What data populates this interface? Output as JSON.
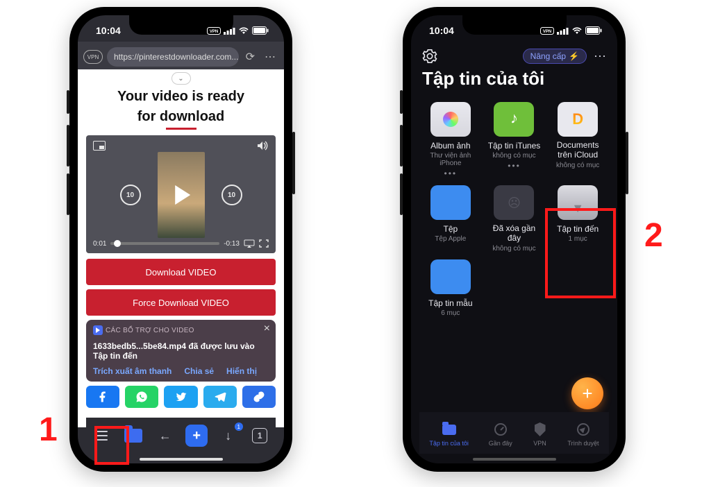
{
  "annotations": {
    "num1": "1",
    "num2": "2"
  },
  "left": {
    "status": {
      "time": "10:04"
    },
    "browser": {
      "vpn": "VPN",
      "url": "https://pinterestdownloader.com..."
    },
    "headline_l1": "Your video is ready",
    "headline_l2": "for download",
    "video": {
      "time_current": "0:01",
      "time_remain": "-0:13",
      "seek_back": "10",
      "seek_fwd": "10"
    },
    "buttons": {
      "download": "Download VIDEO",
      "force": "Force Download VIDEO"
    },
    "toast": {
      "badge": "CÁC BỔ TRỢ CHO VIDEO",
      "filename": "1633bedb5...5be84.mp4",
      "saved_suffix": " đã được lưu vào",
      "dest": "Tập tin đến",
      "actions": {
        "extract": "Trích xuất âm thanh",
        "share": "Chia sẻ",
        "show": "Hiển thị"
      }
    },
    "bottom": {
      "down_count": "1",
      "tabs": "1"
    }
  },
  "right": {
    "status": {
      "time": "10:04"
    },
    "header": {
      "upgrade": "Nâng cấp"
    },
    "title": "Tập tin của tôi",
    "grid": [
      {
        "icon": "photos",
        "t1": "Album ảnh",
        "t2": "Thư viện ảnh iPhone",
        "dots": true
      },
      {
        "icon": "itunes",
        "t1": "Tập tin iTunes",
        "t2": "không có mục",
        "dots": true
      },
      {
        "icon": "icloud",
        "t1": "Documents trên iCloud",
        "t2": "không có mục",
        "dots": false,
        "two_line_t1": true
      },
      {
        "icon": "files",
        "t1": "Tệp",
        "t2": "Tệp Apple",
        "dots": false
      },
      {
        "icon": "trash",
        "t1": "Đã xóa gần đây",
        "t2": "không có mục",
        "dots": false,
        "two_line_t1": true
      },
      {
        "icon": "inbox",
        "t1": "Tập tin đến",
        "t2": "1 mục",
        "dots": false
      },
      {
        "icon": "sample",
        "t1": "Tập tin mẫu",
        "t2": "6 mục",
        "dots": false
      }
    ],
    "tabbar": {
      "files": "Tập tin của tôi",
      "recent": "Gần đây",
      "vpn": "VPN",
      "browser": "Trình duyệt"
    }
  }
}
